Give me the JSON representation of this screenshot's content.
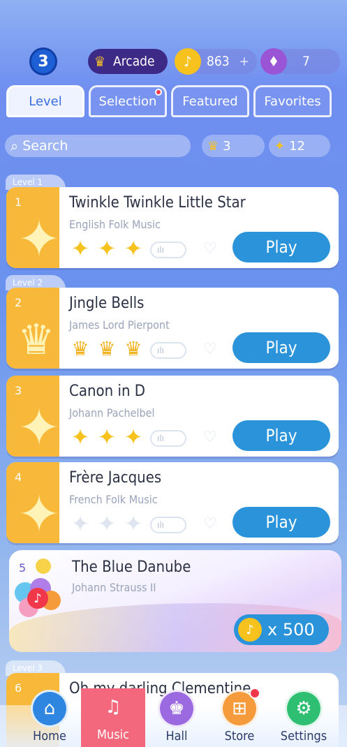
{
  "header": {
    "level_badge": "3",
    "arcade_label": "Arcade",
    "coins_value": "863",
    "coins_add": "+",
    "gems_value": "7"
  },
  "tabs": [
    {
      "label": "Level",
      "active": true
    },
    {
      "label": "Selection",
      "active": false,
      "notification": true
    },
    {
      "label": "Featured",
      "active": false
    },
    {
      "label": "Favorites",
      "active": false
    }
  ],
  "search": {
    "placeholder": "Search"
  },
  "counters": {
    "crowns": "3",
    "stars": "12"
  },
  "levels": [
    {
      "tag": "Level  1"
    },
    {
      "tag": "Level  2"
    },
    {
      "tag": "Level  3"
    }
  ],
  "songs": [
    {
      "num": "1",
      "title": "Twinkle Twinkle Little Star",
      "artist": "English Folk Music",
      "rating_type": "stars",
      "rating": 3,
      "play": "Play"
    },
    {
      "num": "2",
      "title": "Jingle Bells",
      "artist": "James Lord Pierpont",
      "rating_type": "crowns",
      "rating": 3,
      "play": "Play"
    },
    {
      "num": "3",
      "title": "Canon in D",
      "artist": "Johann Pachelbel",
      "rating_type": "stars",
      "rating": 3,
      "play": "Play"
    },
    {
      "num": "4",
      "title": "Frère Jacques",
      "artist": "French Folk Music",
      "rating_type": "stars",
      "rating": 0,
      "play": "Play"
    }
  ],
  "special_song": {
    "num": "5",
    "title": "The Blue Danube",
    "artist": "Johann Strauss II",
    "price": "x 500"
  },
  "next_song": {
    "num": "6",
    "title": "Oh my darling Clementine"
  },
  "nav": [
    {
      "label": "Home",
      "icon": "home-icon",
      "color": "#2f86e0"
    },
    {
      "label": "Music",
      "icon": "music-icon",
      "color": "#f4687e",
      "active": true
    },
    {
      "label": "Hall",
      "icon": "trophy-icon",
      "color": "#9b6ae0"
    },
    {
      "label": "Store",
      "icon": "cart-icon",
      "color": "#f59b3b",
      "notification": true
    },
    {
      "label": "Settings",
      "icon": "gear-icon",
      "color": "#2fbf73"
    }
  ]
}
